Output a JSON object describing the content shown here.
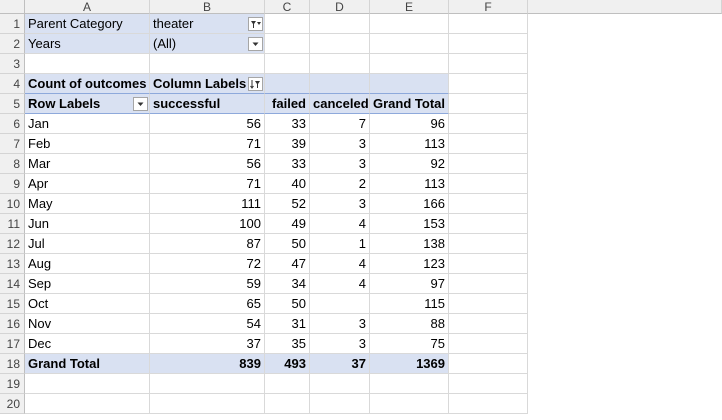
{
  "columns": [
    "A",
    "B",
    "C",
    "D",
    "E",
    "F"
  ],
  "rows": [
    "1",
    "2",
    "3",
    "4",
    "5",
    "6",
    "7",
    "8",
    "9",
    "10",
    "11",
    "12",
    "13",
    "14",
    "15",
    "16",
    "17",
    "18",
    "19",
    "20"
  ],
  "filters": {
    "parent_category_label": "Parent Category",
    "parent_category_value": "theater",
    "years_label": "Years",
    "years_value": "(All)"
  },
  "pivot": {
    "corner_label": "Count of outcomes",
    "column_labels": "Column Labels",
    "row_labels": "Row Labels",
    "headers": [
      "successful",
      "failed",
      "canceled",
      "Grand Total"
    ],
    "data": [
      {
        "label": "Jan",
        "successful": "56",
        "failed": "33",
        "canceled": "7",
        "total": "96"
      },
      {
        "label": "Feb",
        "successful": "71",
        "failed": "39",
        "canceled": "3",
        "total": "113"
      },
      {
        "label": "Mar",
        "successful": "56",
        "failed": "33",
        "canceled": "3",
        "total": "92"
      },
      {
        "label": "Apr",
        "successful": "71",
        "failed": "40",
        "canceled": "2",
        "total": "113"
      },
      {
        "label": "May",
        "successful": "111",
        "failed": "52",
        "canceled": "3",
        "total": "166"
      },
      {
        "label": "Jun",
        "successful": "100",
        "failed": "49",
        "canceled": "4",
        "total": "153"
      },
      {
        "label": "Jul",
        "successful": "87",
        "failed": "50",
        "canceled": "1",
        "total": "138"
      },
      {
        "label": "Aug",
        "successful": "72",
        "failed": "47",
        "canceled": "4",
        "total": "123"
      },
      {
        "label": "Sep",
        "successful": "59",
        "failed": "34",
        "canceled": "4",
        "total": "97"
      },
      {
        "label": "Oct",
        "successful": "65",
        "failed": "50",
        "canceled": "",
        "total": "115"
      },
      {
        "label": "Nov",
        "successful": "54",
        "failed": "31",
        "canceled": "3",
        "total": "88"
      },
      {
        "label": "Dec",
        "successful": "37",
        "failed": "35",
        "canceled": "3",
        "total": "75"
      }
    ],
    "grand_total": {
      "label": "Grand Total",
      "successful": "839",
      "failed": "493",
      "canceled": "37",
      "total": "1369"
    }
  },
  "icons": [
    "filter-dropdown-icon",
    "dropdown-arrow-icon",
    "sort-filter-icon"
  ]
}
